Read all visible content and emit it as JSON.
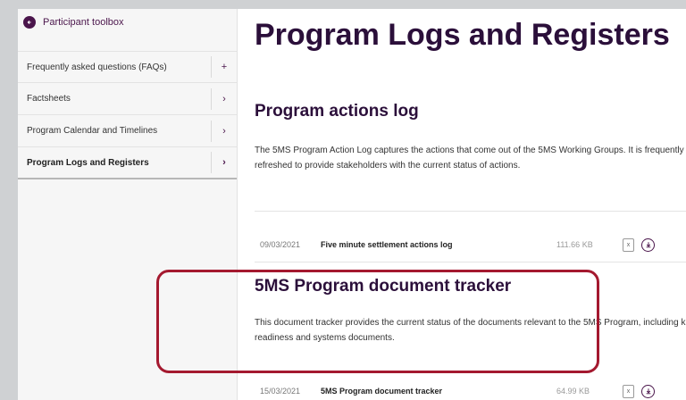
{
  "sidebar": {
    "header_label": "Participant toolbox",
    "items": [
      {
        "label": "Frequently asked questions (FAQs)",
        "toggle": "+"
      },
      {
        "label": "Factsheets",
        "toggle": "›"
      },
      {
        "label": "Program Calendar and Timelines",
        "toggle": "›"
      },
      {
        "label": "Program Logs and Registers",
        "toggle": "›",
        "active": true
      }
    ]
  },
  "main": {
    "title": "Program Logs and Registers",
    "sections": [
      {
        "title": "Program actions log",
        "description": "The 5MS Program Action Log captures the actions that come out of the 5MS Working Groups. It is frequently refreshed to provide stakeholders with the current status of actions.",
        "files": [
          {
            "date": "09/03/2021",
            "name": "Five minute settlement actions log",
            "size": "111.66 KB",
            "type_icon": "excel-file-icon"
          }
        ]
      },
      {
        "title": "5MS Program document tracker",
        "description": "This document tracker provides the current status of the documents relevant to the 5MS Program, including key readiness and systems documents.",
        "files": [
          {
            "date": "15/03/2021",
            "name": "5MS Program document tracker",
            "size": "64.99 KB",
            "type_icon": "excel-file-icon"
          }
        ]
      }
    ]
  },
  "colors": {
    "brand": "#2b0f3a",
    "accent": "#4a154b",
    "highlight": "#a4192f"
  }
}
